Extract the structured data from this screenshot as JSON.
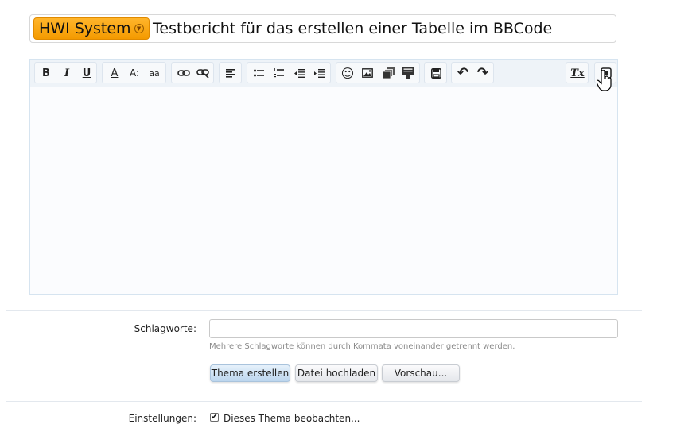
{
  "thread": {
    "prefix_label": "HWI System",
    "title": "Testbericht für das erstellen einer Tabelle im BBCode"
  },
  "editor": {
    "toolbar": [
      {
        "name": "bold-button",
        "icon": "bold-icon",
        "glyph": "B"
      },
      {
        "name": "italic-button",
        "icon": "italic-icon",
        "glyph": "I"
      },
      {
        "name": "underline-button",
        "icon": "underline-icon",
        "glyph": "U"
      },
      {
        "name": "font-color-button",
        "icon": "font-color-icon",
        "glyph": "A"
      },
      {
        "name": "font-size-button",
        "icon": "font-size-icon",
        "glyph": "A:"
      },
      {
        "name": "font-family-button",
        "icon": "font-family-icon",
        "glyph": "aa"
      },
      {
        "name": "link-button",
        "icon": "link-icon"
      },
      {
        "name": "unlink-button",
        "icon": "unlink-icon"
      },
      {
        "name": "align-button",
        "icon": "align-left-icon"
      },
      {
        "name": "bullet-list-button",
        "icon": "bullet-list-icon"
      },
      {
        "name": "number-list-button",
        "icon": "number-list-icon"
      },
      {
        "name": "outdent-button",
        "icon": "outdent-icon"
      },
      {
        "name": "indent-button",
        "icon": "indent-icon"
      },
      {
        "name": "smilie-button",
        "icon": "smilie-icon",
        "glyph": "☺"
      },
      {
        "name": "image-button",
        "icon": "image-icon"
      },
      {
        "name": "media-button",
        "icon": "media-icon"
      },
      {
        "name": "insert-button",
        "icon": "insert-icon"
      },
      {
        "name": "save-draft-button",
        "icon": "save-icon"
      },
      {
        "name": "undo-button",
        "icon": "undo-icon",
        "glyph": "↶"
      },
      {
        "name": "redo-button",
        "icon": "redo-icon",
        "glyph": "↷"
      },
      {
        "name": "remove-format-button",
        "icon": "remove-format-icon",
        "glyph": "Tx"
      },
      {
        "name": "toggle-bbcode-button",
        "icon": "bbcode-toggle-icon"
      }
    ]
  },
  "form": {
    "tags_label": "Schlagworte:",
    "tags_value": "",
    "tags_hint": "Mehrere Schlagworte können durch Kommata voneinander getrennt werden.",
    "buttons": {
      "create": "Thema erstellen",
      "upload": "Datei hochladen",
      "preview": "Vorschau..."
    },
    "settings_label": "Einstellungen:",
    "watch_label": "Dieses Thema beobachten...",
    "watch_checked": true
  },
  "colors": {
    "prefix_bg": "#f49a00",
    "toolbar_bg": "#eef3f8",
    "primary_button": "#bcd6ee"
  }
}
